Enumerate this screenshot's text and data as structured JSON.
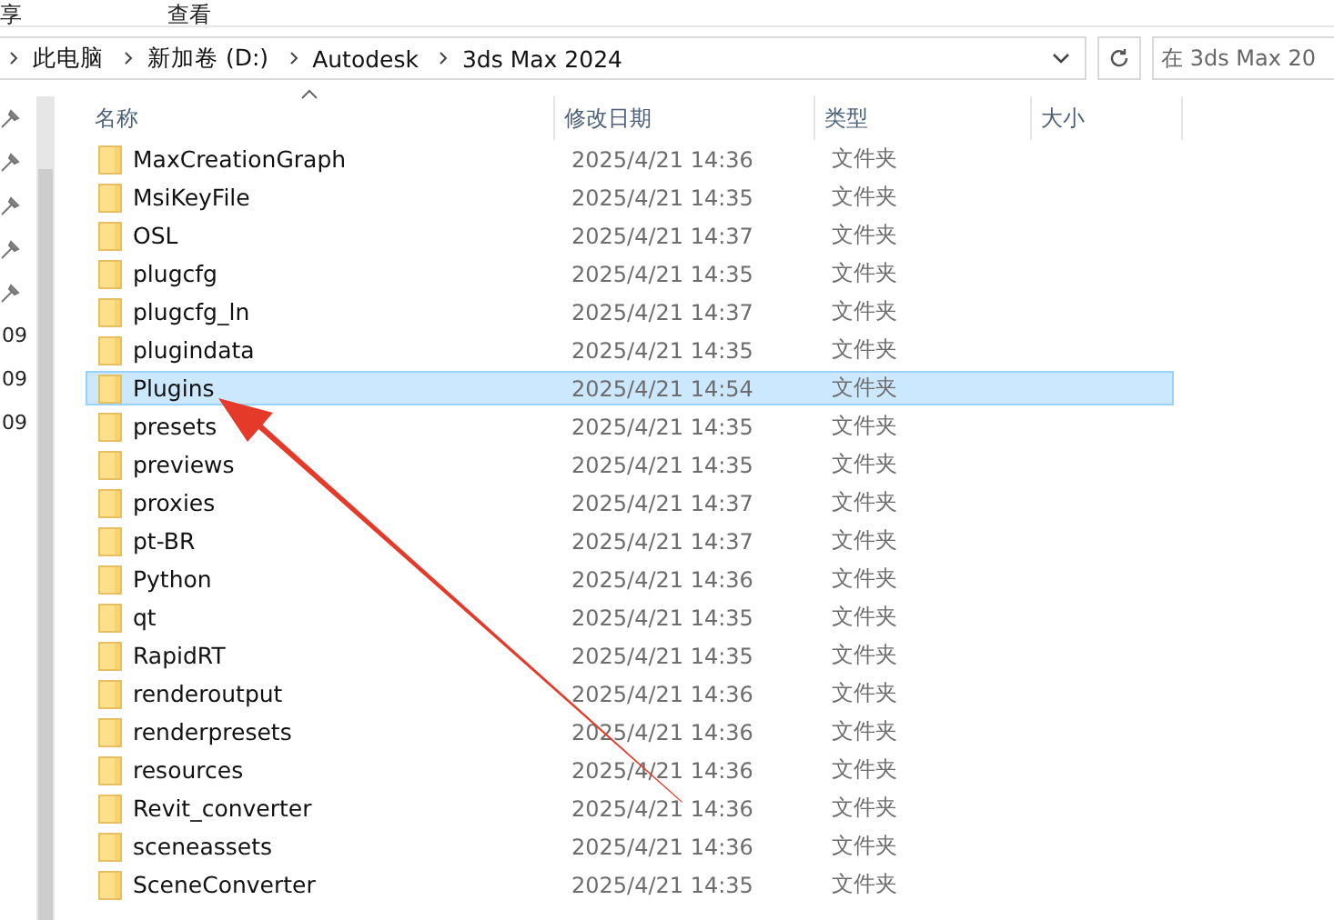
{
  "menu": [
    "享",
    "查看"
  ],
  "breadcrumb": [
    "此电脑",
    "新加卷 (D:)",
    "Autodesk",
    "3ds Max 2024"
  ],
  "search": {
    "placeholder": "在 3ds Max 20"
  },
  "nav_pane": [
    {
      "kind": "pin"
    },
    {
      "kind": "pin"
    },
    {
      "kind": "pin"
    },
    {
      "kind": "pin"
    },
    {
      "kind": "pin"
    },
    {
      "kind": "label",
      "label": "09"
    },
    {
      "kind": "label",
      "label": "09"
    },
    {
      "kind": "label",
      "label": "09"
    }
  ],
  "columns": [
    "名称",
    "修改日期",
    "类型",
    "大小"
  ],
  "rows": [
    {
      "name": "MaxCreationGraph",
      "date": "2025/4/21 14:36",
      "type": "文件夹",
      "selected": false
    },
    {
      "name": "MsiKeyFile",
      "date": "2025/4/21 14:35",
      "type": "文件夹",
      "selected": false
    },
    {
      "name": "OSL",
      "date": "2025/4/21 14:37",
      "type": "文件夹",
      "selected": false
    },
    {
      "name": "plugcfg",
      "date": "2025/4/21 14:35",
      "type": "文件夹",
      "selected": false
    },
    {
      "name": "plugcfg_ln",
      "date": "2025/4/21 14:37",
      "type": "文件夹",
      "selected": false
    },
    {
      "name": "plugindata",
      "date": "2025/4/21 14:35",
      "type": "文件夹",
      "selected": false
    },
    {
      "name": "Plugins",
      "date": "2025/4/21 14:54",
      "type": "文件夹",
      "selected": true
    },
    {
      "name": "presets",
      "date": "2025/4/21 14:35",
      "type": "文件夹",
      "selected": false
    },
    {
      "name": "previews",
      "date": "2025/4/21 14:35",
      "type": "文件夹",
      "selected": false
    },
    {
      "name": "proxies",
      "date": "2025/4/21 14:37",
      "type": "文件夹",
      "selected": false
    },
    {
      "name": "pt-BR",
      "date": "2025/4/21 14:37",
      "type": "文件夹",
      "selected": false
    },
    {
      "name": "Python",
      "date": "2025/4/21 14:36",
      "type": "文件夹",
      "selected": false
    },
    {
      "name": "qt",
      "date": "2025/4/21 14:35",
      "type": "文件夹",
      "selected": false
    },
    {
      "name": "RapidRT",
      "date": "2025/4/21 14:35",
      "type": "文件夹",
      "selected": false
    },
    {
      "name": "renderoutput",
      "date": "2025/4/21 14:36",
      "type": "文件夹",
      "selected": false
    },
    {
      "name": "renderpresets",
      "date": "2025/4/21 14:36",
      "type": "文件夹",
      "selected": false
    },
    {
      "name": "resources",
      "date": "2025/4/21 14:36",
      "type": "文件夹",
      "selected": false
    },
    {
      "name": "Revit_converter",
      "date": "2025/4/21 14:36",
      "type": "文件夹",
      "selected": false
    },
    {
      "name": "sceneassets",
      "date": "2025/4/21 14:36",
      "type": "文件夹",
      "selected": false
    },
    {
      "name": "SceneConverter",
      "date": "2025/4/21 14:35",
      "type": "文件夹",
      "selected": false
    }
  ]
}
